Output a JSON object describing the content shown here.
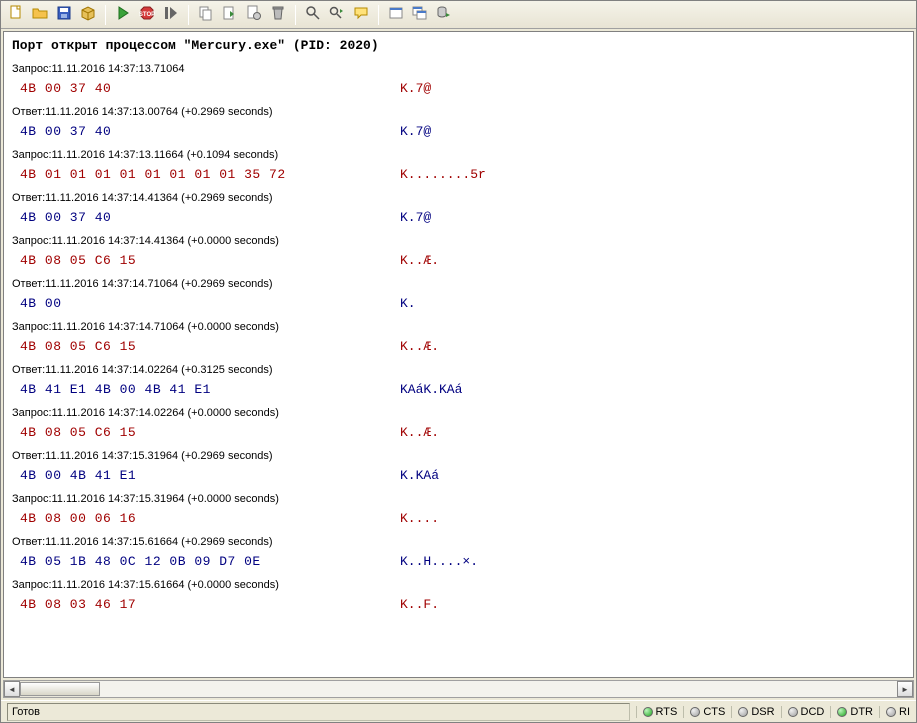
{
  "toolbar": {
    "icons": [
      "new-file-icon",
      "open-file-icon",
      "save-icon",
      "package-icon",
      "sep",
      "play-icon",
      "stop-icon",
      "step-icon",
      "sep",
      "copy-page-icon",
      "export-icon",
      "page-gear-icon",
      "trash-icon",
      "sep",
      "find-icon",
      "find-next-icon",
      "comment-icon",
      "sep",
      "window-icon",
      "windows-icon",
      "export-db-icon"
    ]
  },
  "header": "Порт открыт процессом \"Mercury.exe\" (PID: 2020)",
  "log": [
    {
      "kind": "req",
      "meta": "Запрос:11.11.2016 14:37:13.71064",
      "hex": "4B 00 37 40",
      "ascii": "K.7@"
    },
    {
      "kind": "resp",
      "meta": "Ответ:11.11.2016 14:37:13.00764 (+0.2969 seconds)",
      "hex": "4B 00 37 40",
      "ascii": "K.7@"
    },
    {
      "kind": "req",
      "meta": "Запрос:11.11.2016 14:37:13.11664 (+0.1094 seconds)",
      "hex": "4B 01 01 01 01 01 01 01 01 35 72",
      "ascii": "K........5r"
    },
    {
      "kind": "resp",
      "meta": "Ответ:11.11.2016 14:37:14.41364 (+0.2969 seconds)",
      "hex": "4B 00 37 40",
      "ascii": "K.7@"
    },
    {
      "kind": "req",
      "meta": "Запрос:11.11.2016 14:37:14.41364 (+0.0000 seconds)",
      "hex": "4B 08 05 C6 15",
      "ascii": "K..Æ."
    },
    {
      "kind": "resp",
      "meta": "Ответ:11.11.2016 14:37:14.71064 (+0.2969 seconds)",
      "hex": "4B 00",
      "ascii": "K."
    },
    {
      "kind": "req",
      "meta": "Запрос:11.11.2016 14:37:14.71064 (+0.0000 seconds)",
      "hex": "4B 08 05 C6 15",
      "ascii": "K..Æ."
    },
    {
      "kind": "resp",
      "meta": "Ответ:11.11.2016 14:37:14.02264 (+0.3125 seconds)",
      "hex": "4B 41 E1 4B 00 4B 41 E1",
      "ascii": "KAáK.KAá"
    },
    {
      "kind": "req",
      "meta": "Запрос:11.11.2016 14:37:14.02264 (+0.0000 seconds)",
      "hex": "4B 08 05 C6 15",
      "ascii": "K..Æ."
    },
    {
      "kind": "resp",
      "meta": "Ответ:11.11.2016 14:37:15.31964 (+0.2969 seconds)",
      "hex": "4B 00 4B 41 E1",
      "ascii": "K.KAá"
    },
    {
      "kind": "req",
      "meta": "Запрос:11.11.2016 14:37:15.31964 (+0.0000 seconds)",
      "hex": "4B 08 00 06 16",
      "ascii": "K...."
    },
    {
      "kind": "resp",
      "meta": "Ответ:11.11.2016 14:37:15.61664 (+0.2969 seconds)",
      "hex": "4B 05 1B 48 0C 12 0B 09 D7 0E",
      "ascii": "K..H....×."
    },
    {
      "kind": "req",
      "meta": "Запрос:11.11.2016 14:37:15.61664 (+0.0000 seconds)",
      "hex": "4B 08 03 46 17",
      "ascii": "K..F."
    }
  ],
  "status": {
    "text": "Готов",
    "indicators": [
      {
        "label": "RTS",
        "on": true
      },
      {
        "label": "CTS",
        "on": false
      },
      {
        "label": "DSR",
        "on": false
      },
      {
        "label": "DCD",
        "on": false
      },
      {
        "label": "DTR",
        "on": true
      },
      {
        "label": "RI",
        "on": false
      }
    ]
  }
}
